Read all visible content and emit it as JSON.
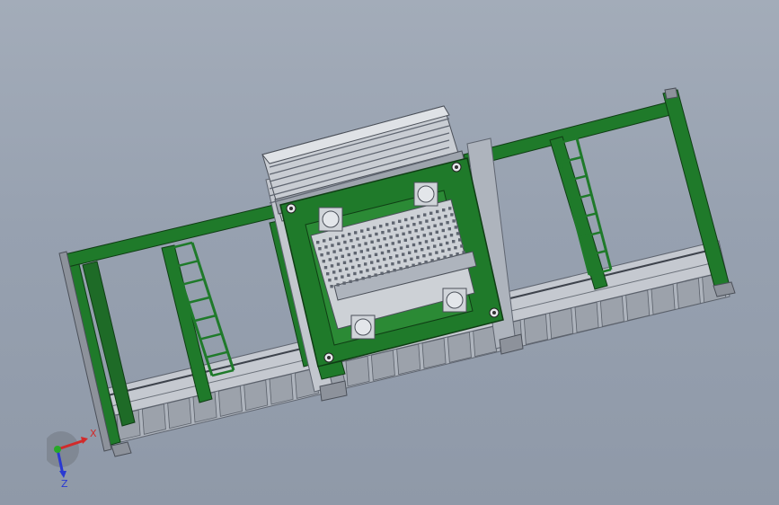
{
  "viewport": {
    "background_top": "#a3acb9",
    "background_bottom": "#8f99a8"
  },
  "model": {
    "frame_color": "#1f7a2a",
    "frame_edge": "#0f3d14",
    "steel_color": "#b7bcc4",
    "steel_dark": "#6f7580"
  },
  "triad": {
    "x_label": "X",
    "z_label": "Z",
    "x_color": "#d22a2a",
    "y_color": "#28a828",
    "z_color": "#2a3ad2"
  }
}
